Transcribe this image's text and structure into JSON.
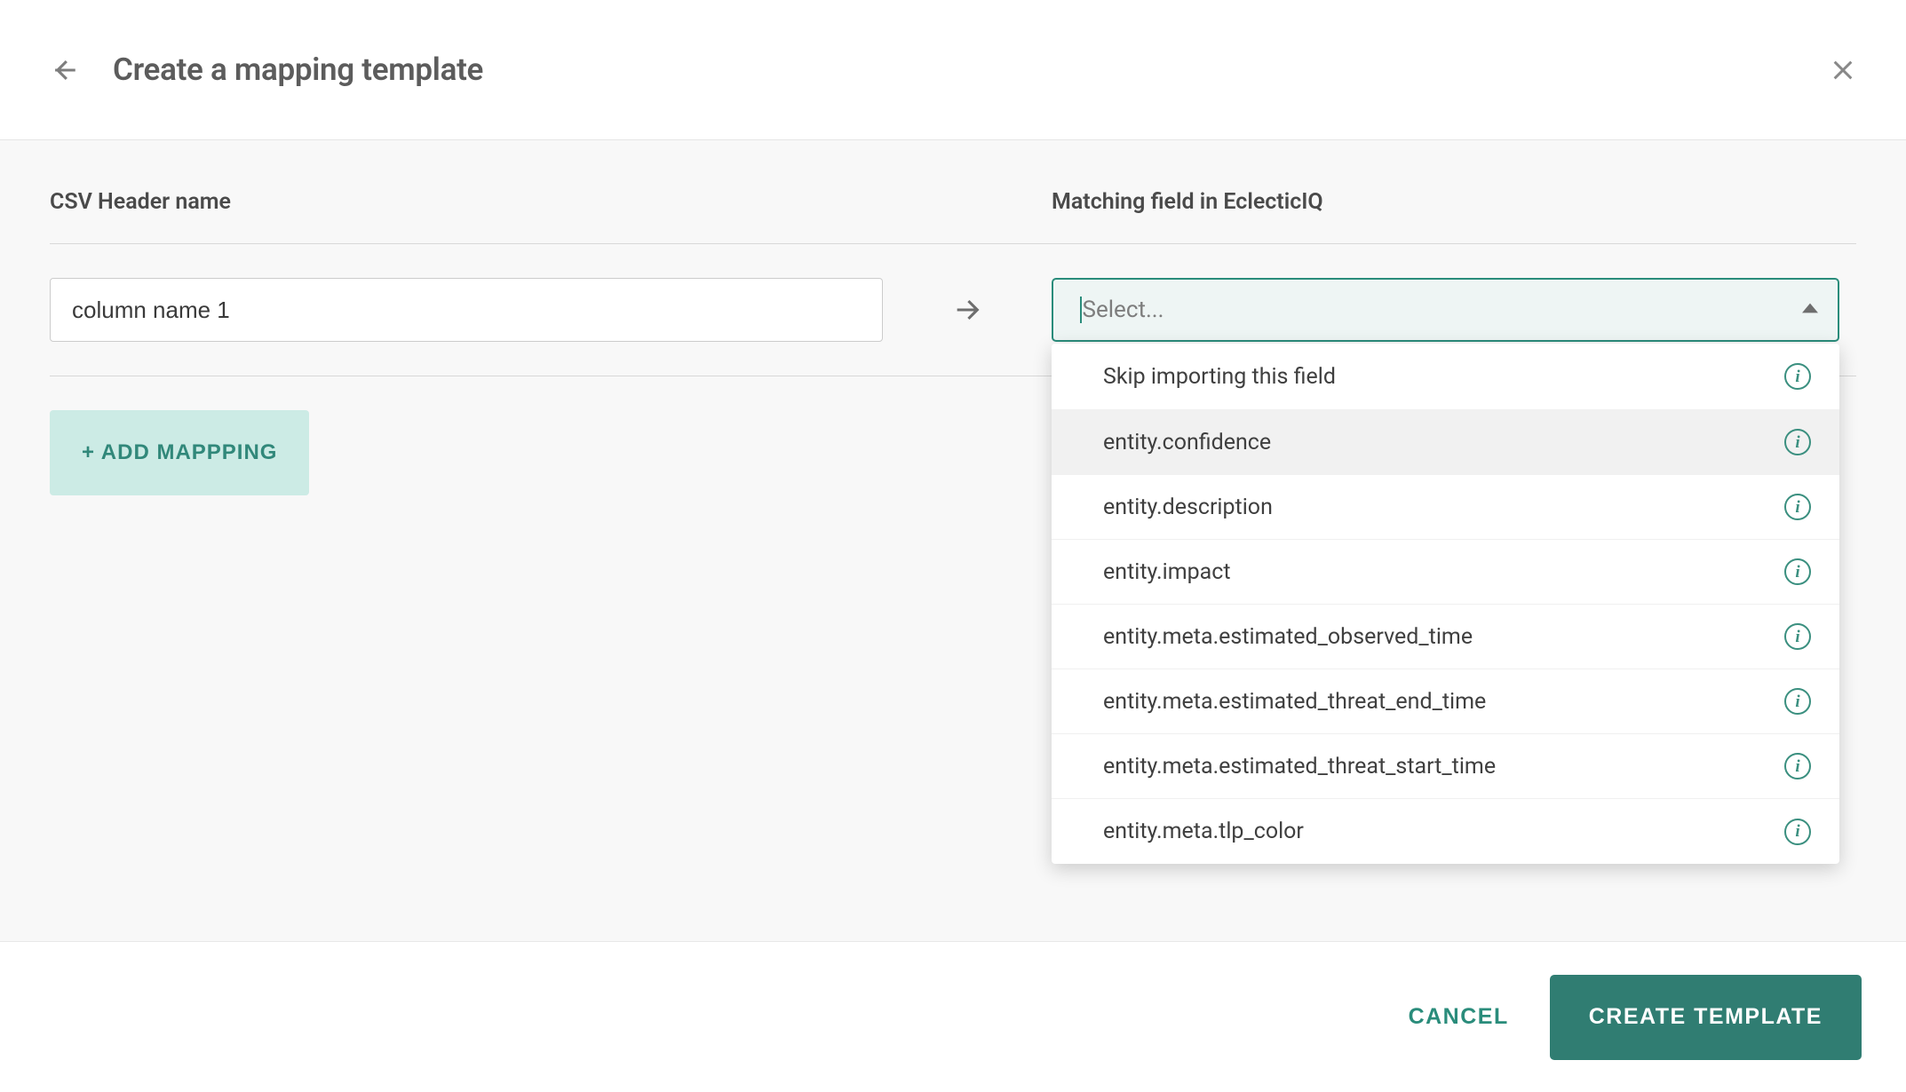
{
  "header": {
    "title": "Create a mapping template"
  },
  "columns": {
    "left_label": "CSV Header name",
    "right_label": "Matching field in EclecticIQ"
  },
  "mapping": {
    "csv_value": "column name 1",
    "select_placeholder": "Select..."
  },
  "add_mapping_label": "+ ADD MAPPPING",
  "dropdown": {
    "options": [
      {
        "label": "Skip importing this field",
        "highlighted": false
      },
      {
        "label": "entity.confidence",
        "highlighted": true
      },
      {
        "label": "entity.description",
        "highlighted": false
      },
      {
        "label": "entity.impact",
        "highlighted": false
      },
      {
        "label": "entity.meta.estimated_observed_time",
        "highlighted": false
      },
      {
        "label": "entity.meta.estimated_threat_end_time",
        "highlighted": false
      },
      {
        "label": "entity.meta.estimated_threat_start_time",
        "highlighted": false
      },
      {
        "label": "entity.meta.tlp_color",
        "highlighted": false
      }
    ]
  },
  "footer": {
    "cancel_label": "CANCEL",
    "create_label": "CREATE TEMPLATE"
  },
  "colors": {
    "accent": "#2a8c7b",
    "accent_dark": "#307d72",
    "accent_light": "#ccebe5"
  }
}
